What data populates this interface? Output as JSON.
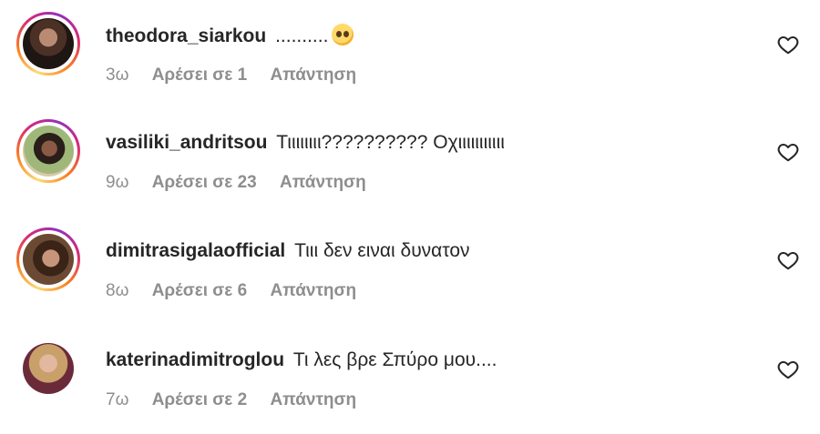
{
  "comments": [
    {
      "username": "theodora_siarkou",
      "text": "..........",
      "emoji": "face-holding-back-tears-emoji",
      "time": "3ω",
      "likes_label": "Αρέσει σε 1",
      "reply_label": "Απάντηση",
      "has_story_ring": true
    },
    {
      "username": "vasiliki_andritsou",
      "text": "Τιιιιιιιι?????????? Οχιιιιιιιιιιι",
      "time": "9ω",
      "likes_label": "Αρέσει σε 23",
      "reply_label": "Απάντηση",
      "has_story_ring": true
    },
    {
      "username": "dimitrasigalaofficial",
      "text": "Τιιι δεν ειναι δυνατον",
      "time": "8ω",
      "likes_label": "Αρέσει σε 6",
      "reply_label": "Απάντηση",
      "has_story_ring": true
    },
    {
      "username": "katerinadimitroglou",
      "text": "Τι λες βρε Σπύρο μου....",
      "time": "7ω",
      "likes_label": "Αρέσει σε 2",
      "reply_label": "Απάντηση",
      "has_story_ring": false
    }
  ],
  "icons": {
    "like": "heart-outline-icon"
  },
  "colors": {
    "text": "#262626",
    "meta": "#8e8e8e",
    "story_ring": [
      "#feda75",
      "#fa7e1e",
      "#d62976",
      "#962fbf"
    ]
  }
}
